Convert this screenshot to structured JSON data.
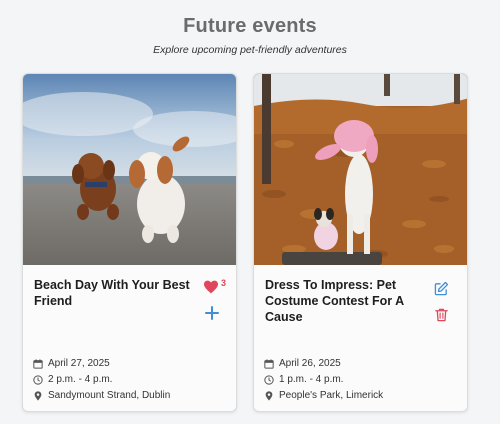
{
  "header": {
    "title": "Future events",
    "subtitle": "Explore upcoming pet-friendly adventures"
  },
  "colors": {
    "accent_red": "#e0475a",
    "accent_blue": "#3f8fd8",
    "title_gray": "#6b6b6b"
  },
  "events": [
    {
      "title": "Beach Day With Your Best Friend",
      "date": "April 27, 2025",
      "time": "2 p.m. - 4 p.m.",
      "location": "Sandymount Strand, Dublin",
      "likes": "3",
      "icons": [
        "heart-icon",
        "plus-icon",
        "calendar-icon",
        "clock-icon",
        "location-pin-icon"
      ]
    },
    {
      "title": "Dress To Impress: Pet Costume Contest For A Cause",
      "date": "April 26, 2025",
      "time": "1 p.m. - 4 p.m.",
      "location": "People's Park, Limerick",
      "icons": [
        "edit-icon",
        "trash-icon",
        "calendar-icon",
        "clock-icon",
        "location-pin-icon"
      ]
    }
  ]
}
